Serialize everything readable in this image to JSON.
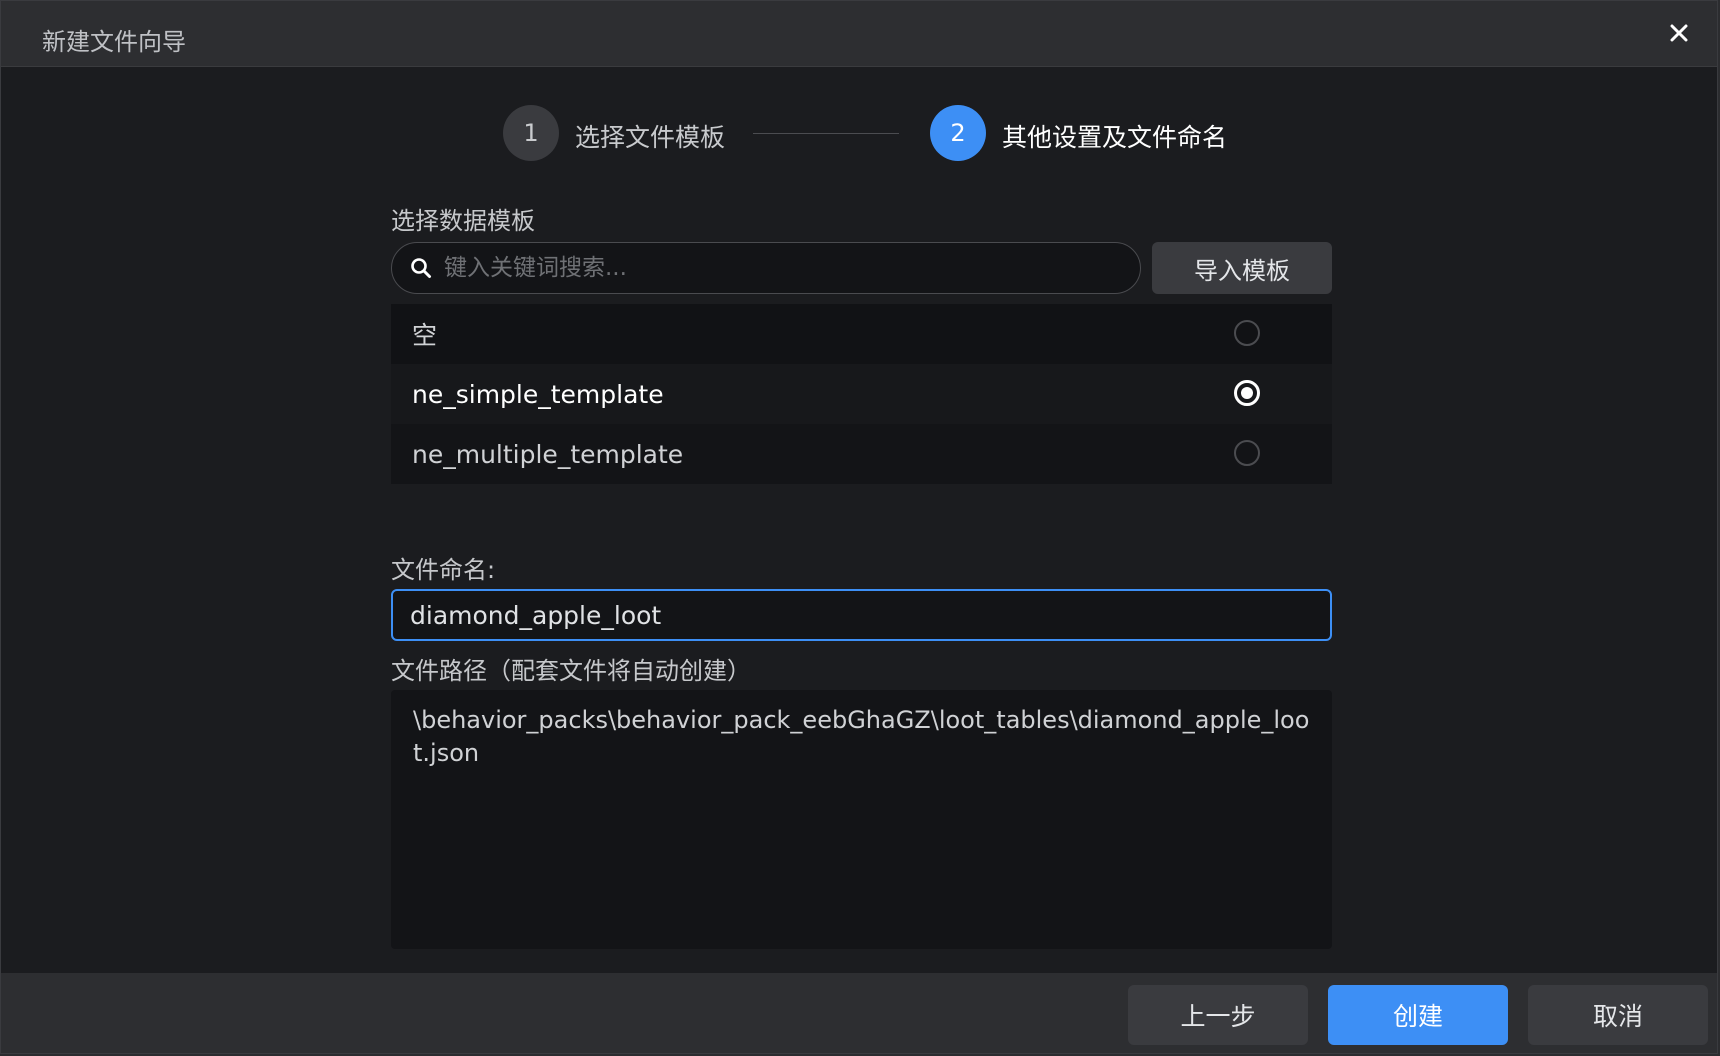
{
  "window": {
    "title": "新建文件向导"
  },
  "steps": [
    {
      "number": "1",
      "label": "选择文件模板"
    },
    {
      "number": "2",
      "label": "其他设置及文件命名"
    }
  ],
  "template_section": {
    "label": "选择数据模板",
    "search_placeholder": "键入关键词搜索...",
    "import_button": "导入模板",
    "items": [
      {
        "label": "空",
        "selected": false
      },
      {
        "label": "ne_simple_template",
        "selected": true
      },
      {
        "label": "ne_multiple_template",
        "selected": false
      }
    ]
  },
  "file_name": {
    "label": "文件命名:",
    "value": "diamond_apple_loot"
  },
  "file_path": {
    "label": "文件路径（配套文件将自动创建）",
    "value": "\\behavior_packs\\behavior_pack_eebGhaGZ\\loot_tables\\diamond_apple_loot.json"
  },
  "footer": {
    "prev_button": "上一步",
    "create_button": "创建",
    "cancel_button": "取消"
  },
  "colors": {
    "accent": "#3d8ff5",
    "background": "#1b1c1f",
    "titlebar": "#2d2e31"
  }
}
